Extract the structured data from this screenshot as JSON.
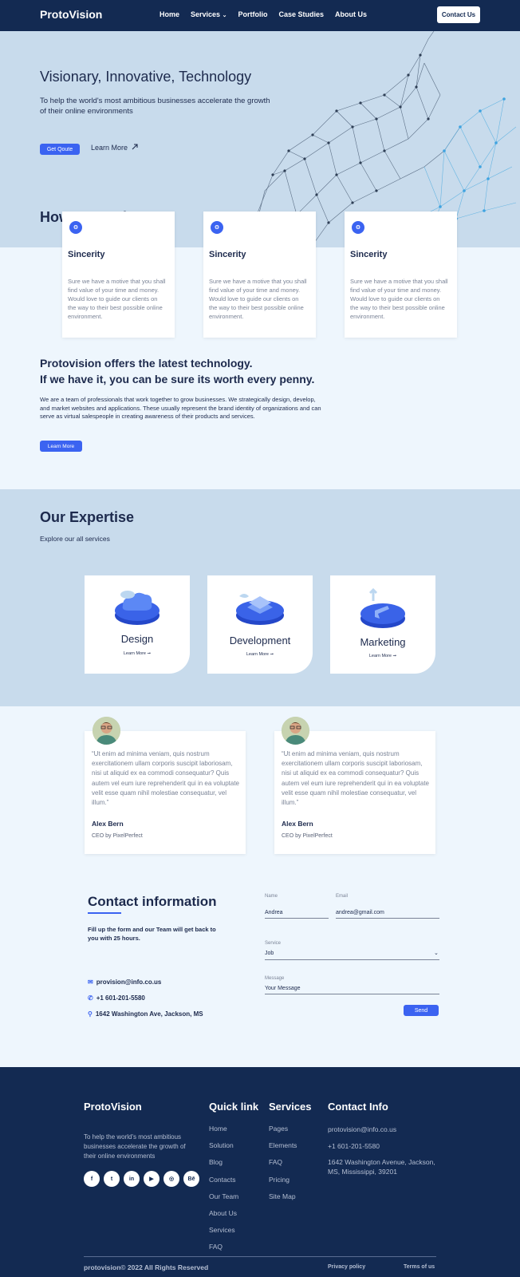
{
  "nav": {
    "brand": "ProtoVision",
    "items": [
      "Home",
      "Services",
      "Portfolio",
      "Case Studies",
      "About Us"
    ],
    "services_chevron": "⌄",
    "contact_button": "Contact Us"
  },
  "hero": {
    "title": "Visionary, Innovative, Technology",
    "subtitle": "To help the world's most ambitious businesses accelerate the growth of their online environments",
    "quote_button": "Get Qoute",
    "learn_more": "Learn More"
  },
  "how": {
    "title": "How we work",
    "cards": [
      {
        "icon": "brain-icon",
        "title": "Sincerity",
        "text": "Sure we have a motive that you shall find value of your time and money. Would love to guide our clients on the way to their best possible online environment."
      },
      {
        "icon": "brain-icon",
        "title": "Sincerity",
        "text": "Sure we have a motive that you shall find value of your time and money. Would love to guide our clients on the way to their best possible online environment."
      },
      {
        "icon": "brain-icon",
        "title": "Sincerity",
        "text": "Sure we have a motive that you shall find value of your time and money. Would love to guide our clients on the way to their best possible online environment."
      }
    ]
  },
  "offer": {
    "title_line1": "Protovision offers the latest technology.",
    "title_line2": "If we have it, you can be sure its worth every penny.",
    "text": "We are a team of professionals that work together to grow businesses. We strategically design, develop, and market websites and applications. These usually represent the brand identity of organizations and can serve as virtual salespeople in creating awareness of their products and services.",
    "button": "Learn More"
  },
  "expertise": {
    "title": "Our Expertise",
    "subtitle": "Explore our all services",
    "cards": [
      {
        "title": "Design",
        "link": "Learn More ➞"
      },
      {
        "title": "Development",
        "link": "Learn More ➞"
      },
      {
        "title": "Marketing",
        "link": "Learn More ➞"
      }
    ]
  },
  "testimonials": [
    {
      "quote": "“Ut enim ad minima veniam, quis nostrum exercitationem ullam corporis suscipit laboriosam, nisi ut aliquid ex ea commodi consequatur? Quis autem vel eum iure reprehenderit qui in ea voluptate velit esse quam nihil molestiae consequatur, vel illum.”",
      "name": "Alex Bern",
      "role": "CEO by PixelPerfect"
    },
    {
      "quote": "“Ut enim ad minima veniam, quis nostrum exercitationem ullam corporis suscipit laboriosam, nisi ut aliquid ex ea commodi consequatur? Quis autem vel eum iure reprehenderit qui in ea voluptate velit esse quam nihil molestiae consequatur, vel illum.”",
      "name": "Alex Bern",
      "role": "CEO by PixelPerfect"
    }
  ],
  "contact": {
    "title": "Contact information",
    "subtitle": "Fill up the form and our Team will get back to you with 25 hours.",
    "email": "provision@info.co.us",
    "phone": "+1 601-201-5580",
    "address": "1642 Washington Ave, Jackson, MS",
    "form": {
      "name_label": "Name",
      "name_value": "Andrea",
      "email_label": "Email",
      "email_value": "andrea@gmail.com",
      "service_label": "Service",
      "service_value": "Job",
      "message_label": "Message",
      "message_value": "Your Message",
      "send": "Send"
    }
  },
  "footer": {
    "brand": "ProtoVision",
    "description": "To help the world's most ambitious businesses accelerate the growth of their online environments",
    "socials": [
      "f",
      "t",
      "in",
      "▶",
      "◎",
      "Bē"
    ],
    "quicklink_title": "Quick link",
    "quicklinks": [
      "Home",
      "Solution",
      "Blog",
      "Contacts",
      "Our Team",
      "About Us",
      "Services",
      "FAQ"
    ],
    "services_title": "Services",
    "services": [
      "Pages",
      "Elements",
      "FAQ",
      "Pricing",
      "Site Map"
    ],
    "contact_title": "Contact Info",
    "contact_email": "protovision@info.co.us",
    "contact_phone": "+1 601-201-5580",
    "contact_address": "1642 Washington Avenue, Jackson, MS, Mississippi, 39201",
    "copyright": "protovision© 2022 All Rights Reserved",
    "privacy": "Privacy policy",
    "terms": "Terms of us"
  },
  "colors": {
    "navy": "#132a52",
    "accent": "#3b63f1",
    "hero_bg": "#c8dbec",
    "page_bg": "#eef6fd"
  }
}
